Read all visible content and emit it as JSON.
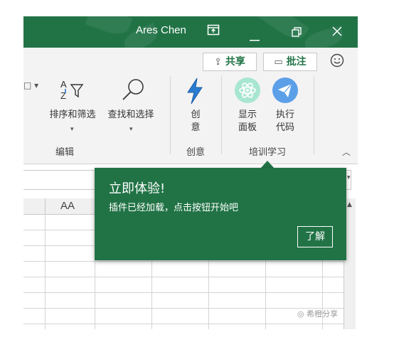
{
  "titlebar": {
    "user_name": "Ares Chen",
    "accent": "#217346",
    "icons": [
      "ribbon-display-options-icon",
      "minimize-icon",
      "restore-icon",
      "close-icon"
    ]
  },
  "header_buttons": {
    "share": "共享",
    "comments": "批注",
    "feedback_icon": "smiley-icon"
  },
  "ribbon": {
    "sort_filter": "排序和筛选",
    "find_select": "查找和选择",
    "editing_group": "编辑",
    "create_line1": "创",
    "create_line2": "意",
    "create_group": "创意",
    "show_panel_line1": "显示",
    "show_panel_line2": "面板",
    "run_code_line1": "执行",
    "run_code_line2": "代码",
    "training_group": "培训学习"
  },
  "sheet": {
    "column_header": "AA"
  },
  "popup": {
    "title": "立即体验!",
    "message": "插件已经加载，点击按钮开始吧",
    "button": "了解"
  },
  "watermark": "希橙分享"
}
